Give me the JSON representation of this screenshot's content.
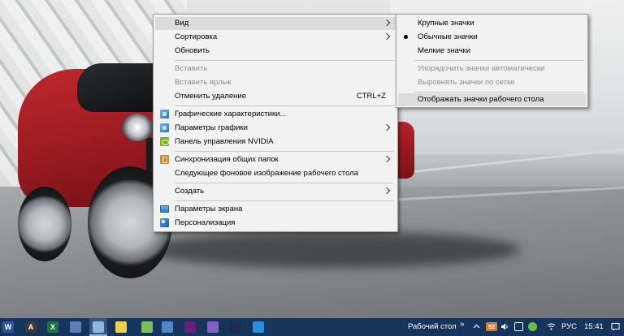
{
  "main_menu": {
    "items": [
      {
        "label": "Вид",
        "has_submenu": true,
        "highlighted": true
      },
      {
        "label": "Сортировка",
        "has_submenu": true
      },
      {
        "label": "Обновить"
      },
      {
        "label": "Вставить",
        "disabled": true
      },
      {
        "label": "Вставить ярлык",
        "disabled": true
      },
      {
        "label": "Отменить удаление",
        "shortcut": "CTRL+Z"
      },
      {
        "label": "Графические характеристики...",
        "icon": "intel-graphics-icon"
      },
      {
        "label": "Параметры графики",
        "icon": "intel-graphics-icon",
        "has_submenu": true
      },
      {
        "label": "Панель управления NVIDIA",
        "icon": "nvidia-icon"
      },
      {
        "label": "Синхронизация общих папок",
        "icon": "sync-folder-icon",
        "has_submenu": true
      },
      {
        "label": "Следующее фоновое изображение рабочего стола"
      },
      {
        "label": "Создать",
        "has_submenu": true
      },
      {
        "label": "Параметры экрана",
        "icon": "display-settings-icon"
      },
      {
        "label": "Персонализация",
        "icon": "personalization-icon"
      }
    ]
  },
  "view_submenu": {
    "items": [
      {
        "label": "Крупные значки"
      },
      {
        "label": "Обычные значки",
        "selected": true
      },
      {
        "label": "Мелкие значки"
      },
      {
        "label": "Упорядочить значки автоматически",
        "disabled": true
      },
      {
        "label": "Выровнять значки по сетке",
        "disabled": true
      },
      {
        "label": "Отображать значки рабочего стола",
        "highlighted": true
      }
    ]
  },
  "taskbar": {
    "apps": [
      {
        "icon": "word-icon",
        "glyph": "W",
        "color": "#2b579a"
      },
      {
        "icon": "app-a-icon",
        "glyph": "A",
        "color": "#3a3a3a"
      },
      {
        "icon": "excel-icon",
        "glyph": "X",
        "color": "#217346"
      },
      {
        "icon": "document-icon",
        "glyph": "",
        "color": "#5a7fb0"
      },
      {
        "icon": "paint-icon",
        "glyph": "",
        "color": "#8fb7d9"
      },
      {
        "icon": "sticky-notes-icon",
        "glyph": "",
        "color": "#f2d14a"
      },
      {
        "icon": "notepad-plus-icon",
        "glyph": "",
        "color": "#7cbf5a"
      },
      {
        "icon": "remote-desktop-icon",
        "glyph": "",
        "color": "#4f86c6"
      },
      {
        "icon": "visual-studio-icon",
        "glyph": "",
        "color": "#68217a"
      },
      {
        "icon": "visual-studio-2-icon",
        "glyph": "",
        "color": "#865fc5"
      },
      {
        "icon": "terminal-icon",
        "glyph": "",
        "color": "#1b2f52"
      },
      {
        "icon": "security-icon",
        "glyph": "",
        "color": "#2d8fd8"
      }
    ],
    "desktop_label": "Рабочий стол",
    "tray_badge": "52",
    "language": "РУС",
    "time": "15:41"
  }
}
